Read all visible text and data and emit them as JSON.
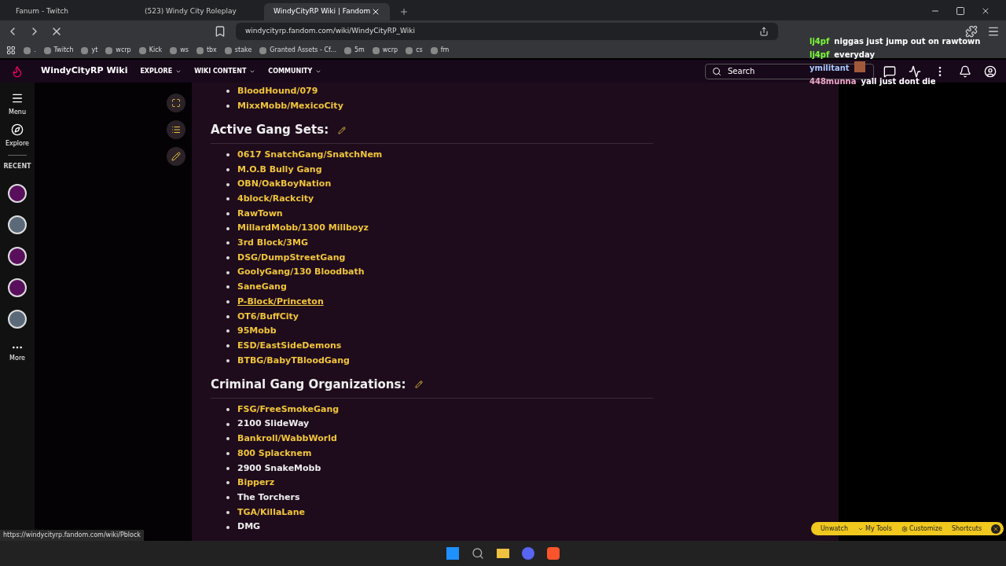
{
  "browser": {
    "tabs": [
      {
        "title": "Fanum - Twitch",
        "selected": false
      },
      {
        "title": "(523) Windy City Roleplay",
        "selected": false
      },
      {
        "title": "WindyCityRP Wiki | Fandom",
        "selected": true
      }
    ],
    "url": "windycityrp.fandom.com/wiki/WindyCityRP_Wiki",
    "bookmarks": [
      ".",
      "Twitch",
      "yt",
      "wcrp",
      "Kick",
      "ws",
      "tbx",
      "stake",
      "Granted Assets - Cf...",
      "5m",
      "wcrp",
      "cs",
      "fm"
    ]
  },
  "chat": [
    {
      "user": "lj4pf",
      "color": "#7cfc3a",
      "message": "niggas just jump out on rawtown"
    },
    {
      "user": "lj4pf",
      "color": "#7cfc3a",
      "message": "everyday"
    },
    {
      "user": "ymilitant",
      "color": "#a9c8ff"
    },
    {
      "user": "448munna",
      "color": "#f0a8c8",
      "message": "yall just dont die"
    }
  ],
  "wiki_nav": {
    "title": "WindyCityRP Wiki",
    "menus": [
      "EXPLORE",
      "WIKI CONTENT",
      "COMMUNITY"
    ],
    "search_placeholder": "Search"
  },
  "sidebar": {
    "items": [
      {
        "label": "Menu"
      },
      {
        "label": "Explore"
      }
    ],
    "recent_label": "RECENT",
    "recent": [
      {
        "kind": "wiki"
      },
      {
        "kind": "photo"
      },
      {
        "kind": "wiki"
      },
      {
        "kind": "wiki"
      },
      {
        "kind": "photo"
      }
    ],
    "more_label": "More"
  },
  "prev_items": [
    {
      "text": "BloodHound/079",
      "kind": "link",
      "hovered": false
    },
    {
      "text": "MixxMobb/MexicoCity",
      "kind": "link",
      "hovered": false
    }
  ],
  "sections": [
    {
      "heading": "Active Gang Sets:",
      "items": [
        {
          "text": "0617 SnatchGang/SnatchNem",
          "kind": "link",
          "hovered": false
        },
        {
          "text": "M.O.B Bully Gang",
          "kind": "link",
          "hovered": false
        },
        {
          "text": "OBN/OakBoyNation",
          "kind": "link",
          "hovered": false
        },
        {
          "text": "4block/Rackcity",
          "kind": "link",
          "hovered": false
        },
        {
          "text": "RawTown",
          "kind": "link",
          "hovered": false
        },
        {
          "text": "MillardMobb/1300 Millboyz",
          "kind": "link",
          "hovered": false
        },
        {
          "text": "3rd Block/3MG",
          "kind": "link",
          "hovered": false
        },
        {
          "text": "DSG/DumpStreetGang",
          "kind": "link",
          "hovered": false
        },
        {
          "text": "GoolyGang/130 Bloodbath",
          "kind": "link",
          "hovered": false
        },
        {
          "text": "SaneGang",
          "kind": "link",
          "hovered": false
        },
        {
          "text": "P-Block/Princeton",
          "kind": "link",
          "hovered": true
        },
        {
          "text": "OT6/BuffCity",
          "kind": "link",
          "hovered": false
        },
        {
          "text": "95Mobb",
          "kind": "link",
          "hovered": false
        },
        {
          "text": "ESD/EastSideDemons",
          "kind": "link",
          "hovered": false
        },
        {
          "text": "BTBG/BabyTBloodGang",
          "kind": "link",
          "hovered": false
        }
      ]
    },
    {
      "heading": "Criminal Gang Organizations:",
      "items": [
        {
          "text": "FSG/FreeSmokeGang",
          "kind": "link",
          "hovered": false
        },
        {
          "text": "2100 SlideWay",
          "kind": "text",
          "hovered": false
        },
        {
          "text": "Bankroll/WabbWorld",
          "kind": "link",
          "hovered": false
        },
        {
          "text": "800 Splacknem",
          "kind": "link",
          "hovered": false
        },
        {
          "text": "2900 SnakeMobb",
          "kind": "text",
          "hovered": false
        },
        {
          "text": "Bipperz",
          "kind": "link",
          "hovered": false
        },
        {
          "text": "The Torchers",
          "kind": "text",
          "hovered": false
        },
        {
          "text": "TGA/KillaLane",
          "kind": "link",
          "hovered": false
        },
        {
          "text": "DMG",
          "kind": "text",
          "hovered": false
        }
      ]
    }
  ],
  "toolbar": [
    "Unwatch",
    "My Tools",
    "Customize",
    "Shortcuts"
  ],
  "status_url": "https://windycityrp.fandom.com/wiki/Pblock"
}
